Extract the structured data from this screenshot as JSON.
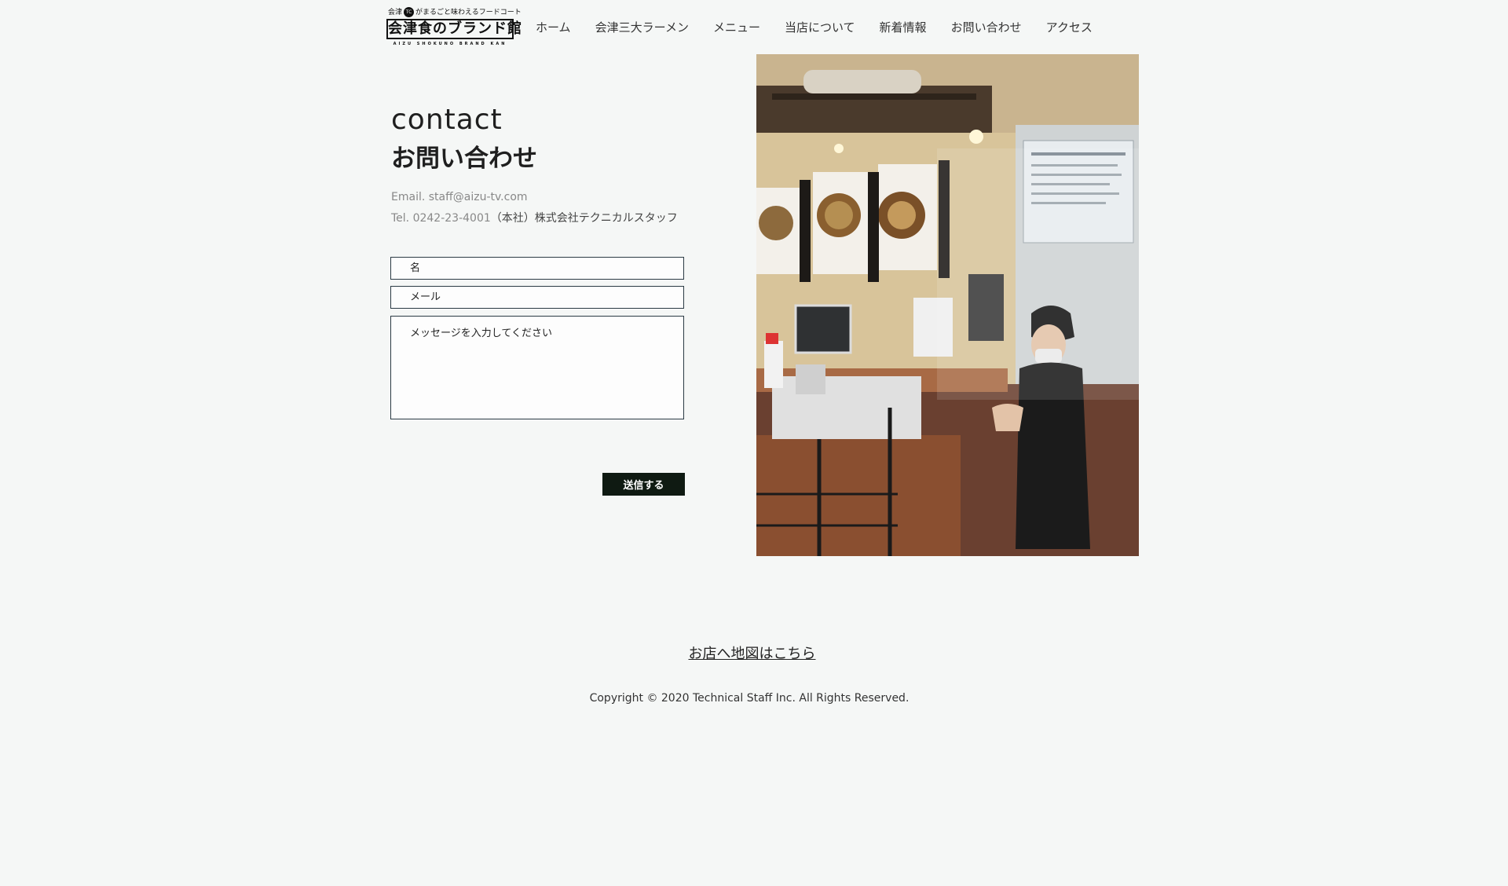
{
  "header": {
    "logo": {
      "tagline_prefix": "会津",
      "tagline_badge": "TC",
      "tagline_suffix": "がまるごと味わえるフードコート",
      "name": "会津食のブランド館",
      "subtitle": "AIZU SHOKUNO BRAND KAN"
    },
    "nav": [
      {
        "label": "ホーム"
      },
      {
        "label": "会津三大ラーメン"
      },
      {
        "label": "メニュー"
      },
      {
        "label": "当店について"
      },
      {
        "label": "新着情報"
      },
      {
        "label": "お問い合わせ"
      },
      {
        "label": "アクセス"
      }
    ]
  },
  "contact": {
    "title_en": "contact",
    "title_ja": "お問い合わせ",
    "email_line": "Email. staff@aizu-tv.com",
    "tel_line": "Tel. 0242-23-4001",
    "company": "（本社）株式会社テクニカルスタッフ"
  },
  "form": {
    "name_placeholder": "名",
    "email_placeholder": "メール",
    "message_placeholder": "メッセージを入力してください",
    "submit_label": "送信する"
  },
  "footer": {
    "map_link": "お店へ地図はこちら",
    "copyright": "Copyright © 2020 Technical Staff Inc. All Rights Reserved."
  },
  "colors": {
    "background": "#f5f7f6",
    "button": "#0f1a12",
    "field_border": "#2b3a44"
  }
}
